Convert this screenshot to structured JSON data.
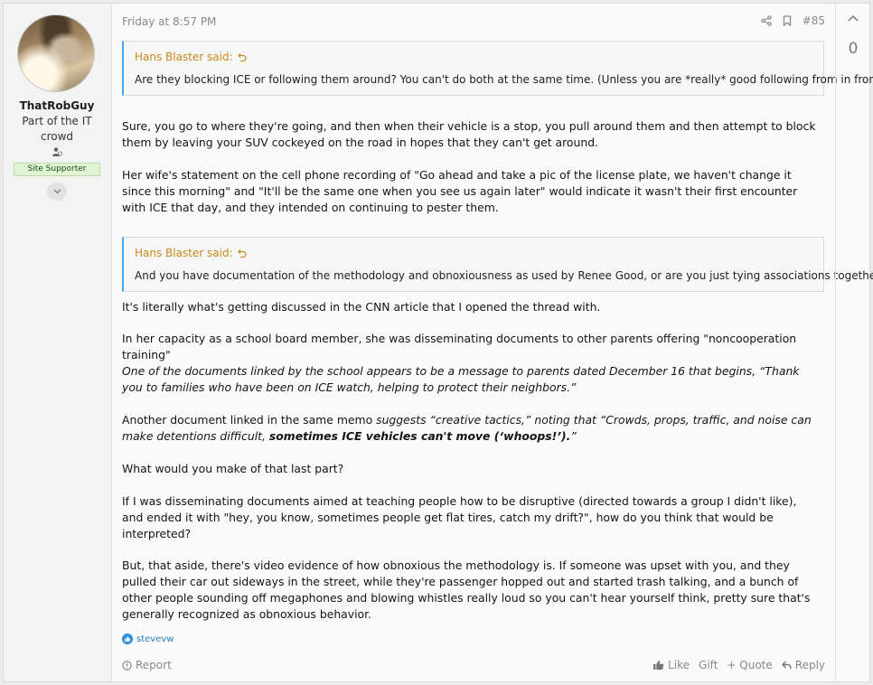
{
  "user": {
    "name": "ThatRobGuy",
    "title": "Part of the IT crowd",
    "badge": "Site Supporter"
  },
  "post": {
    "date": "Friday at 8:57 PM",
    "number": "#85",
    "quotes": [
      {
        "author": "Hans Blaster said:",
        "text": "Are they blocking ICE or following them around? You can't do both at the same time. (Unless you are *really* good following from in front.)"
      },
      {
        "author": "Hans Blaster said:",
        "text": "And you have documentation of the methodology and obnoxiousness as used by Renee Good, or are you just tying associations together?"
      }
    ],
    "paragraphs": {
      "p1": "Sure, you go to where they're going, and then when their vehicle is a stop, you pull around them and then attempt to block them by leaving your SUV cockeyed on the road in hopes that they can't get around.",
      "p2": "Her wife's statement on the cell phone recording of \"Go ahead and take a pic of the license plate, we haven't change it since this morning\" and \"It'll be the same one when you see us again later\" would indicate it wasn't their first encounter with ICE that day, and they intended on continuing to pester them.",
      "p3": "It's literally what's getting discussed in the CNN article that I opened the thread with.",
      "p4": "In her capacity as a school board member, she was disseminating documents to other parents offering \"noncooperation training\"",
      "p5": "One of the documents linked by the school appears to be a message to parents dated December 16 that begins, “Thank you to families who have been on ICE watch, helping to protect their neighbors.”",
      "p6a": "Another document linked in the same memo ",
      "p6b": "suggests “creative tactics,” noting that “Crowds, props, traffic, and noise can make detentions difficult, ",
      "p6c": "sometimes ICE vehicles can't move (‘whoops!’).",
      "p6d": "”",
      "p7": "What would you make of that last part?",
      "p8": "If I was disseminating documents aimed at teaching people how to be disruptive (directed towards a group I didn't like), and ended it with \"hey, you know, sometimes people get flat tires, catch my drift?\", how do you think that would be interpreted?",
      "p9": "But, that aside, there's video evidence of how obnoxious the methodology is. If someone was upset with you, and they pulled their car out sideways in the street, while they're passenger hopped out and started trash talking, and a bunch of other people sounding off megaphones and blowing whistles really loud so you can't hear yourself think, pretty sure that's generally recognized as obnoxious behavior."
    },
    "reaction_user": "stevevw"
  },
  "footer": {
    "report": "Report",
    "like": "Like",
    "gift": "Gift",
    "quote": "+ Quote",
    "reply": "Reply"
  },
  "vote": {
    "count": "0"
  },
  "colors": {
    "quote_author": "#c8891e",
    "quote_border": "#47a7eb",
    "badge_bg": "#dff5d5",
    "link": "#2b7fc0"
  }
}
